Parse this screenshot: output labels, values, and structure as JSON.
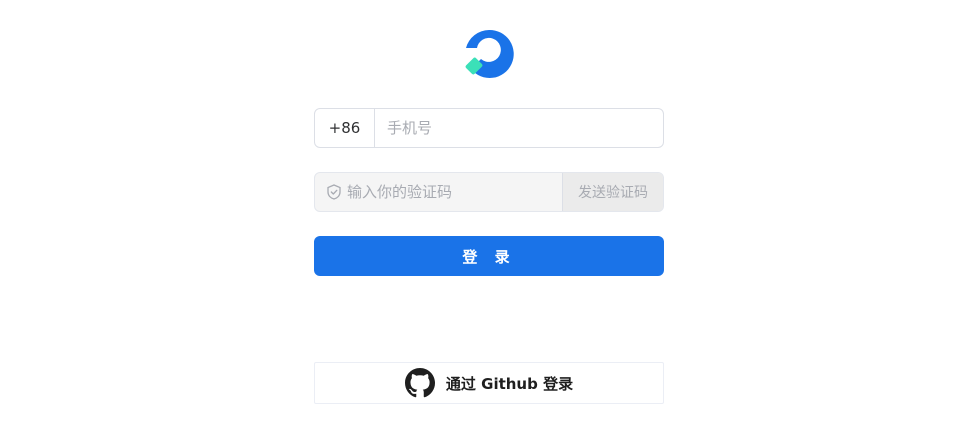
{
  "logo": {
    "name": "app-logo",
    "primary_color": "#1a73e8",
    "accent_color": "#3be0b8"
  },
  "phone": {
    "country_code": "+86",
    "placeholder": "手机号",
    "value": ""
  },
  "verify": {
    "placeholder": "输入你的验证码",
    "value": "",
    "icon": "shield-check-icon",
    "send_label": "发送验证码"
  },
  "login": {
    "label": "登 录",
    "color": "#1a73e8"
  },
  "github": {
    "label": "通过 Github 登录",
    "icon": "github-icon"
  }
}
